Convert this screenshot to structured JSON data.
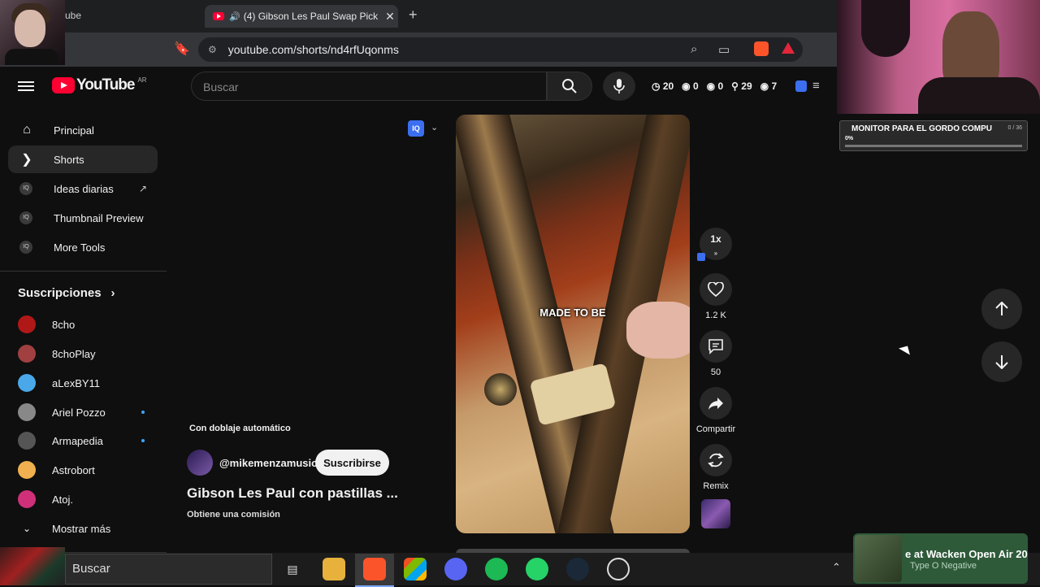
{
  "browser": {
    "prev_tab_fragment": "ube",
    "tab_title": "(4) Gibson Les Paul Swap Pick",
    "url": "youtube.com/shorts/nd4rfUqonms"
  },
  "stream_overlay": {
    "widget_title": "MONITOR PARA EL GORDO COMPU",
    "widget_count": "0 / 36",
    "widget_percent": "0%"
  },
  "header": {
    "logo": "YouTube",
    "country": "AR",
    "search_placeholder": "Buscar",
    "stats": [
      "20",
      "0",
      "0",
      "29",
      "7"
    ]
  },
  "sidebar": {
    "items": [
      {
        "label": "Principal",
        "icon": "home-icon"
      },
      {
        "label": "Shorts",
        "icon": "shorts-icon"
      },
      {
        "label": "Ideas diarias",
        "icon": "iq-icon"
      },
      {
        "label": "Thumbnail Preview",
        "icon": "iq-icon"
      },
      {
        "label": "More Tools",
        "icon": "iq-icon"
      }
    ],
    "subs_title": "Suscripciones",
    "subs": [
      {
        "name": "8cho",
        "color": "#b01818"
      },
      {
        "name": "8choPlay",
        "color": "#a04040"
      },
      {
        "name": "aLexBY11",
        "color": "#4aa8e8"
      },
      {
        "name": "Ariel Pozzo",
        "color": "#888888"
      },
      {
        "name": "Armapedia",
        "color": "#555555"
      },
      {
        "name": "Astrobort",
        "color": "#f0b050"
      },
      {
        "name": "Atoj.",
        "color": "#d0307a"
      }
    ],
    "show_more": "Mostrar más"
  },
  "short": {
    "caption": "MADE TO BE",
    "dub_label": "Con doblaje automático",
    "channel": "@mikemenzamusic",
    "subscribe": "Suscribirse",
    "title": "Gibson Les Paul con pastillas ...",
    "commission": "Obtiene una comisión",
    "speed": "1x",
    "likes": "1.2 K",
    "comments": "50",
    "share": "Compartir",
    "remix": "Remix"
  },
  "taskbar": {
    "search": "Buscar",
    "now_playing_title": "e at Wacken Open Air 20",
    "now_playing_artist": "Type O Negative"
  }
}
